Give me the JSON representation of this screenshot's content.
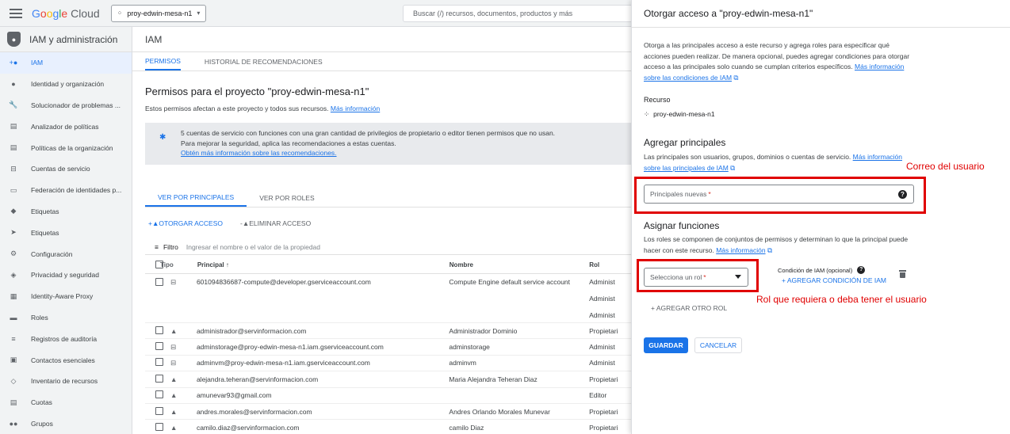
{
  "topbar": {
    "logo_google": "Google",
    "logo_cloud": " Cloud",
    "project": "proy-edwin-mesa-n1",
    "search_placeholder": "Buscar (/) recursos, documentos, productos y más"
  },
  "sidebar": {
    "title": "IAM y administración",
    "items": [
      {
        "label": "IAM",
        "icon": "add-person-icon"
      },
      {
        "label": "Identidad y organización",
        "icon": "account-circle-icon"
      },
      {
        "label": "Solucionador de problemas ...",
        "icon": "wrench-icon"
      },
      {
        "label": "Analizador de políticas",
        "icon": "search-doc-icon"
      },
      {
        "label": "Políticas de la organización",
        "icon": "list-doc-icon"
      },
      {
        "label": "Cuentas de servicio",
        "icon": "service-account-icon"
      },
      {
        "label": "Federación de identidades p...",
        "icon": "id-card-icon"
      },
      {
        "label": "Etiquetas",
        "icon": "tag-icon"
      },
      {
        "label": "Etiquetas",
        "icon": "label-icon"
      },
      {
        "label": "Configuración",
        "icon": "gear-icon"
      },
      {
        "label": "Privacidad y seguridad",
        "icon": "shield-icon"
      },
      {
        "label": "Identity-Aware Proxy",
        "icon": "grid-icon"
      },
      {
        "label": "Roles",
        "icon": "roles-icon"
      },
      {
        "label": "Registros de auditoría",
        "icon": "lines-icon"
      },
      {
        "label": "Contactos esenciales",
        "icon": "contact-icon"
      },
      {
        "label": "Inventario de recursos",
        "icon": "diamond-icon"
      },
      {
        "label": "Cuotas",
        "icon": "quota-icon"
      },
      {
        "label": "Grupos",
        "icon": "groups-icon"
      }
    ]
  },
  "main": {
    "title": "IAM",
    "tabs": [
      "PERMISOS",
      "HISTORIAL DE RECOMENDACIONES"
    ],
    "perm_title": "Permisos para el proyecto \"proy-edwin-mesa-n1\"",
    "perm_sub": "Estos permisos afectan a este proyecto y todos sus recursos.",
    "perm_sub_link": "Más información",
    "banner_line1": "5 cuentas de servicio con funciones con una gran cantidad de privilegios de propietario o editor tienen permisos que no usan.",
    "banner_line2": "Para mejorar la seguridad, aplica las recomendaciones a estas cuentas.",
    "banner_link": "Obtén más información sobre las recomendaciones.",
    "view_tabs": [
      "VER POR PRINCIPALES",
      "VER POR ROLES"
    ],
    "grant_access": "OTORGAR ACCESO",
    "remove_access": "ELIMINAR ACCESO",
    "filter_label": "Filtro",
    "filter_placeholder": "Ingresar el nombre o el valor de la propiedad",
    "columns": {
      "type": "Tipo",
      "principal": "Principal",
      "name": "Nombre",
      "role": "Rol"
    },
    "first_row": {
      "principal": "601094836687-compute@developer.gserviceaccount.com",
      "name": "Compute Engine default service account",
      "roles": [
        "Administ",
        "Administ",
        "Administ"
      ]
    },
    "rows": [
      {
        "type": "person",
        "principal": "administrador@servinformacion.com",
        "name": "Administrador Dominio",
        "role": "Propietari"
      },
      {
        "type": "service",
        "principal": "adminstorage@proy-edwin-mesa-n1.iam.gserviceaccount.com",
        "name": "adminstorage",
        "role": "Administ"
      },
      {
        "type": "service",
        "principal": "adminvm@proy-edwin-mesa-n1.iam.gserviceaccount.com",
        "name": "adminvm",
        "role": "Administ"
      },
      {
        "type": "person",
        "principal": "alejandra.teheran@servinformacion.com",
        "name": "Maria Alejandra Teheran Diaz",
        "role": "Propietari"
      },
      {
        "type": "person",
        "principal": "amunevar93@gmail.com",
        "name": "",
        "role": "Editor"
      },
      {
        "type": "person",
        "principal": "andres.morales@servinformacion.com",
        "name": "Andres Orlando Morales Munevar",
        "role": "Propietari"
      },
      {
        "type": "person",
        "principal": "camilo.diaz@servinformacion.com",
        "name": "camilo Diaz",
        "role": "Propietari"
      }
    ]
  },
  "panel": {
    "title": "Otorgar acceso a \"proy-edwin-mesa-n1\"",
    "intro": "Otorga a las principales acceso a este recurso y agrega roles para especificar qué acciones pueden realizar. De manera opcional, puedes agregar condiciones para otorgar acceso a las principales solo cuando se cumplan criterios específicos.",
    "intro_link": "Más información sobre las condiciones de IAM",
    "resource_label": "Recurso",
    "resource_value": "proy-edwin-mesa-n1",
    "add_principals_title": "Agregar principales",
    "add_principals_desc": "Las principales son usuarios, grupos, dominios o cuentas de servicio.",
    "add_principals_link": "Más información sobre las principales de IAM",
    "new_principals_placeholder": "Principales nuevas",
    "assign_title": "Asignar funciones",
    "assign_desc": "Los roles se componen de conjuntos de permisos y determinan lo que la principal puede hacer con este recurso.",
    "assign_link": "Más información",
    "select_role_placeholder": "Selecciona un rol",
    "condition_label": "Condición de IAM (opcional)",
    "add_condition": "AGREGAR CONDICIÓN DE IAM",
    "add_role": "AGREGAR OTRO ROL",
    "save": "GUARDAR",
    "cancel": "CANCELAR"
  },
  "annotations": {
    "email_note": "Correo del usuario",
    "role_note": "Rol que requiera o deba tener el usuario",
    "color": "#e00000"
  }
}
